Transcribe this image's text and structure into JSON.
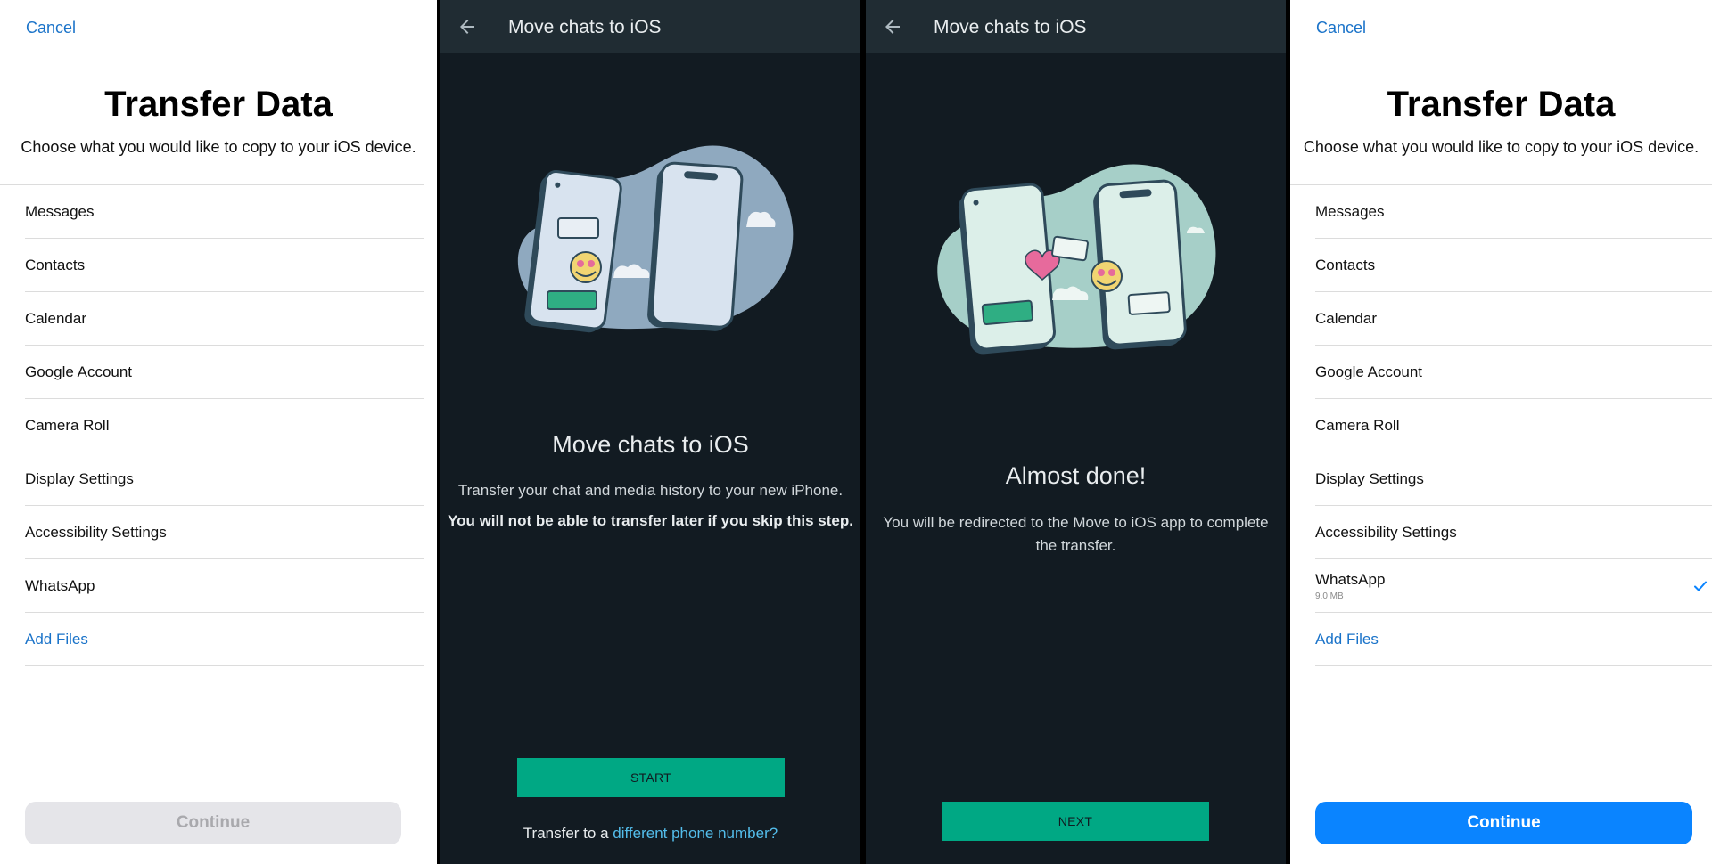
{
  "ios_left": {
    "cancel": "Cancel",
    "title": "Transfer Data",
    "subtitle": "Choose what you would like to copy to your iOS device.",
    "items": [
      {
        "label": "Messages"
      },
      {
        "label": "Contacts"
      },
      {
        "label": "Calendar"
      },
      {
        "label": "Google Account"
      },
      {
        "label": "Camera Roll"
      },
      {
        "label": "Display Settings"
      },
      {
        "label": "Accessibility Settings"
      },
      {
        "label": "WhatsApp"
      }
    ],
    "add_files": "Add Files",
    "continue": "Continue",
    "continue_state": "disabled"
  },
  "wa_start": {
    "bar_title": "Move chats to iOS",
    "heading": "Move chats to iOS",
    "body": "Transfer your chat and media history to your new iPhone.",
    "warning": "You will not be able to transfer later if you skip this step.",
    "button": "START",
    "footer_prefix": "Transfer to a ",
    "footer_link": "different phone number?",
    "illustration_bg": "#8fa9bf"
  },
  "wa_done": {
    "bar_title": "Move chats to iOS",
    "heading": "Almost done!",
    "body": "You will be redirected to the Move to iOS app to complete the transfer.",
    "button": "NEXT",
    "illustration_bg": "#a6cfc8"
  },
  "ios_right": {
    "cancel": "Cancel",
    "title": "Transfer Data",
    "subtitle": "Choose what you would like to copy to your iOS device.",
    "items": [
      {
        "label": "Messages"
      },
      {
        "label": "Contacts"
      },
      {
        "label": "Calendar"
      },
      {
        "label": "Google Account"
      },
      {
        "label": "Camera Roll"
      },
      {
        "label": "Display Settings"
      },
      {
        "label": "Accessibility Settings"
      },
      {
        "label": "WhatsApp",
        "size": "9.0 MB",
        "checked": true
      }
    ],
    "add_files": "Add Files",
    "continue": "Continue",
    "continue_state": "enabled"
  },
  "colors": {
    "ios_link": "#1a73c9",
    "ios_continue_active": "#0a84ff",
    "wa_dark_bg": "#121b22",
    "wa_bar": "#202c33",
    "wa_green": "#00a884",
    "wa_link": "#53bdeb"
  },
  "icons": [
    "back-arrow-icon",
    "checkmark-icon",
    "phone-illustration"
  ]
}
